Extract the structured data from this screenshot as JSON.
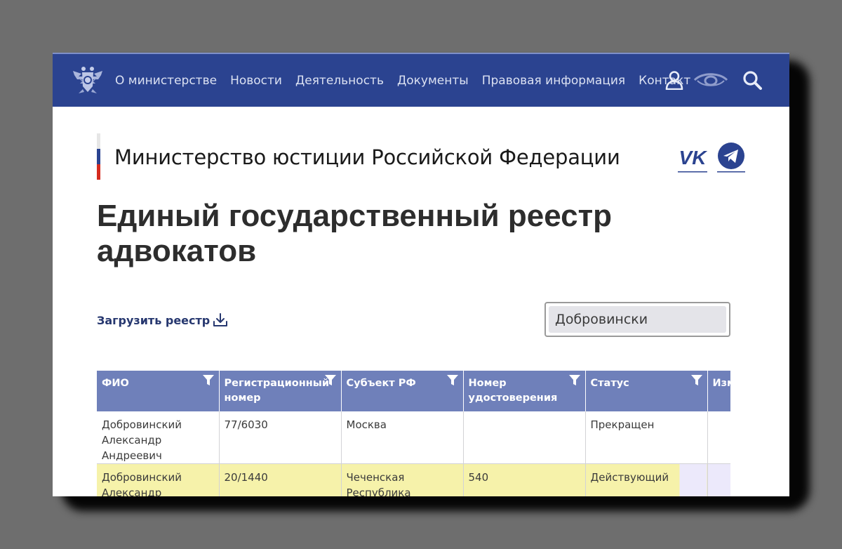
{
  "nav": {
    "menu": [
      {
        "label": "О министерстве"
      },
      {
        "label": "Новости"
      },
      {
        "label": "Деятельность"
      },
      {
        "label": "Документы"
      },
      {
        "label": "Правовая информация"
      },
      {
        "label": "Контакт"
      }
    ],
    "icons": [
      "emblem-icon",
      "user-icon",
      "eye-icon",
      "search-icon"
    ],
    "background": "#2b4390",
    "text_color": "#dbe1f2"
  },
  "header": {
    "ministry_name": "Министерство юстиции Российской Федерации",
    "social": [
      "vk-icon",
      "telegram-icon"
    ],
    "flag_colors": [
      "#ffffff",
      "#2b4390",
      "#d52b1e"
    ]
  },
  "page": {
    "title": "Единый государственный реестр адвокатов"
  },
  "download": {
    "label": "Загрузить реестр",
    "icon": "download-icon"
  },
  "search": {
    "value": "Добровински"
  },
  "table": {
    "columns": [
      {
        "label": "ФИО"
      },
      {
        "label": "Регистрационный номер"
      },
      {
        "label": "Субъект РФ"
      },
      {
        "label": "Номер удостоверения"
      },
      {
        "label": "Статус"
      },
      {
        "label": "Изм"
      }
    ],
    "header_color": "#6f80ba",
    "highlight_color": "#f6f2aa",
    "rows": [
      {
        "name": "Добровинский Александр Андреевич",
        "reg_number": "77/6030",
        "region": "Москва",
        "cert_number": "",
        "status": "Прекращен",
        "extra": ""
      },
      {
        "name": "Добровинский Александр Андреевич",
        "reg_number": "20/1440",
        "region": "Чеченская Республика",
        "cert_number": "540",
        "status": "Действующий",
        "extra": ""
      }
    ]
  }
}
